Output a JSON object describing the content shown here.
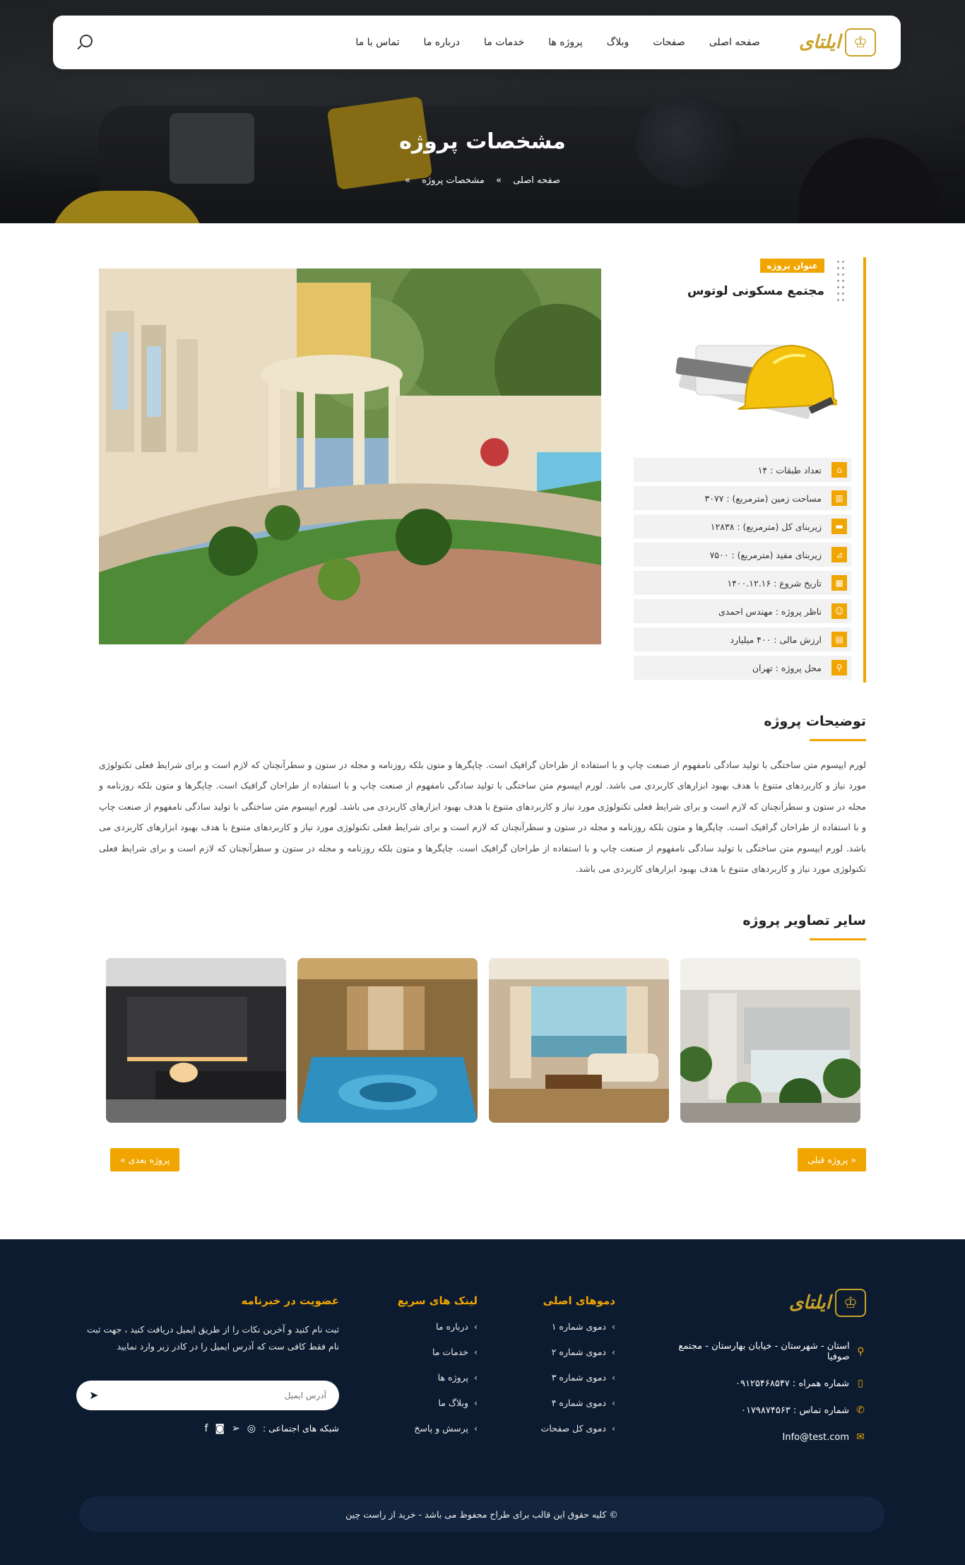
{
  "nav": {
    "logo_text": "ایلتای",
    "menu": [
      "صفحه اصلی",
      "صفحات",
      "وبلاگ",
      "پروژه ها",
      "خدمات ما",
      "درباره ما",
      "تماس با ما"
    ]
  },
  "hero": {
    "title": "مشخصات پروژه",
    "breadcrumb": [
      "صفحه اصلی",
      "مشخصات پروژه"
    ],
    "separator": "»"
  },
  "project": {
    "label": "عنوان پروژه",
    "name": "مجتمع مسکونی لوتوس",
    "specs": [
      {
        "icon": "home-icon",
        "text": "تعداد طبقات : ۱۴"
      },
      {
        "icon": "chart-icon",
        "text": "مساحت زمین (مترمربع) : ۳۰۷۷"
      },
      {
        "icon": "bed-icon",
        "text": "زیربنای کل (مترمربع) : ۱۲۸۳۸"
      },
      {
        "icon": "area-icon",
        "text": "زیربنای مفید (مترمربع) : ۷۵۰۰"
      },
      {
        "icon": "calendar-icon",
        "text": "تاریخ شروع : ۱۴۰۰.۱۲.۱۶"
      },
      {
        "icon": "user-icon",
        "text": "ناظر پروژه : مهندس احمدی"
      },
      {
        "icon": "money-icon",
        "text": "ارزش مالی : ۴۰۰ میلیارد"
      },
      {
        "icon": "location-icon",
        "text": "محل پروژه : تهران"
      }
    ]
  },
  "description": {
    "title": "توضیحات پروژه",
    "text": "لورم ایپسوم متن ساختگی با تولید سادگی نامفهوم از صنعت چاپ و با استفاده از طراحان گرافیک است. چاپگرها و متون بلکه روزنامه و مجله در ستون و سطرآنچنان که لازم است و برای شرایط فعلی تکنولوژی مورد نیاز و کاربردهای متنوع با هدف بهبود ابزارهای کاربردی می باشد. لورم ایپسوم متن ساختگی با تولید سادگی نامفهوم از صنعت چاپ و با استفاده از طراحان گرافیک است. چاپگرها و متون بلکه روزنامه و مجله در ستون و سطرآنچنان که لازم است و برای شرایط فعلی تکنولوژی مورد نیاز و کاربردهای متنوع با هدف بهبود ابزارهای کاربردی می باشد. لورم ایپسوم متن ساختگی با تولید سادگی نامفهوم از صنعت چاپ و با استفاده از طراحان گرافیک است. چاپگرها و متون بلکه روزنامه و مجله در ستون و سطرآنچنان که لازم است و برای شرایط فعلی تکنولوژی مورد نیاز و کاربردهای متنوع با هدف بهبود ابزارهای کاربردی می باشد. لورم ایپسوم متن ساختگی با تولید سادگی نامفهوم از صنعت چاپ و با استفاده از طراحان گرافیک است. چاپگرها و متون بلکه روزنامه و مجله در ستون و سطرآنچنان که لازم است و برای شرایط فعلی تکنولوژی مورد نیاز و کاربردهای متنوع با هدف بهبود ابزارهای کاربردی می باشد."
  },
  "gallery": {
    "title": "سایر تصاویر پروژه"
  },
  "pager": {
    "prev": "« پروژه قبلی",
    "next": "پروژه بعدی »"
  },
  "footer": {
    "logo_text": "ایلتای",
    "address": "استان - شهرستان - خیابان بهارستان - مجتمع صوفیا",
    "mobile": "شماره همراه : ۰۹۱۲۵۴۶۸۵۴۷",
    "phone": "شماره تماس : ۰۱۷۹۸۷۴۵۶۳",
    "email": "Info@test.com",
    "demos_title": "دموهای اصلی",
    "demos": [
      "دموی شماره ۱",
      "دموی شماره ۲",
      "دموی شماره ۳",
      "دموی شماره ۴",
      "دموی کل صفحات"
    ],
    "links_title": "لینک های سریع",
    "links": [
      "درباره ما",
      "خدمات ما",
      "پروژه ها",
      "وبلاگ ما",
      "پرسش و پاسخ"
    ],
    "news_title": "عضویت در خبرنامه",
    "news_text": "ثبت نام کنید و آخرین نکات را از طریق ایمیل دریافت کنید ، جهت ثبت نام فقط کافی ست که آدرس ایمیل را در کادر زیر وارد نمایید",
    "email_placeholder": "آدرس ایمیل",
    "social_label": "شبکه های اجتماعی :",
    "copyright": "© کلیه حقوق این قالب برای طراح محفوظ می باشد - خرید از راست چین"
  },
  "colors": {
    "accent": "#f0a500",
    "footer_bg": "#0c1b30"
  }
}
